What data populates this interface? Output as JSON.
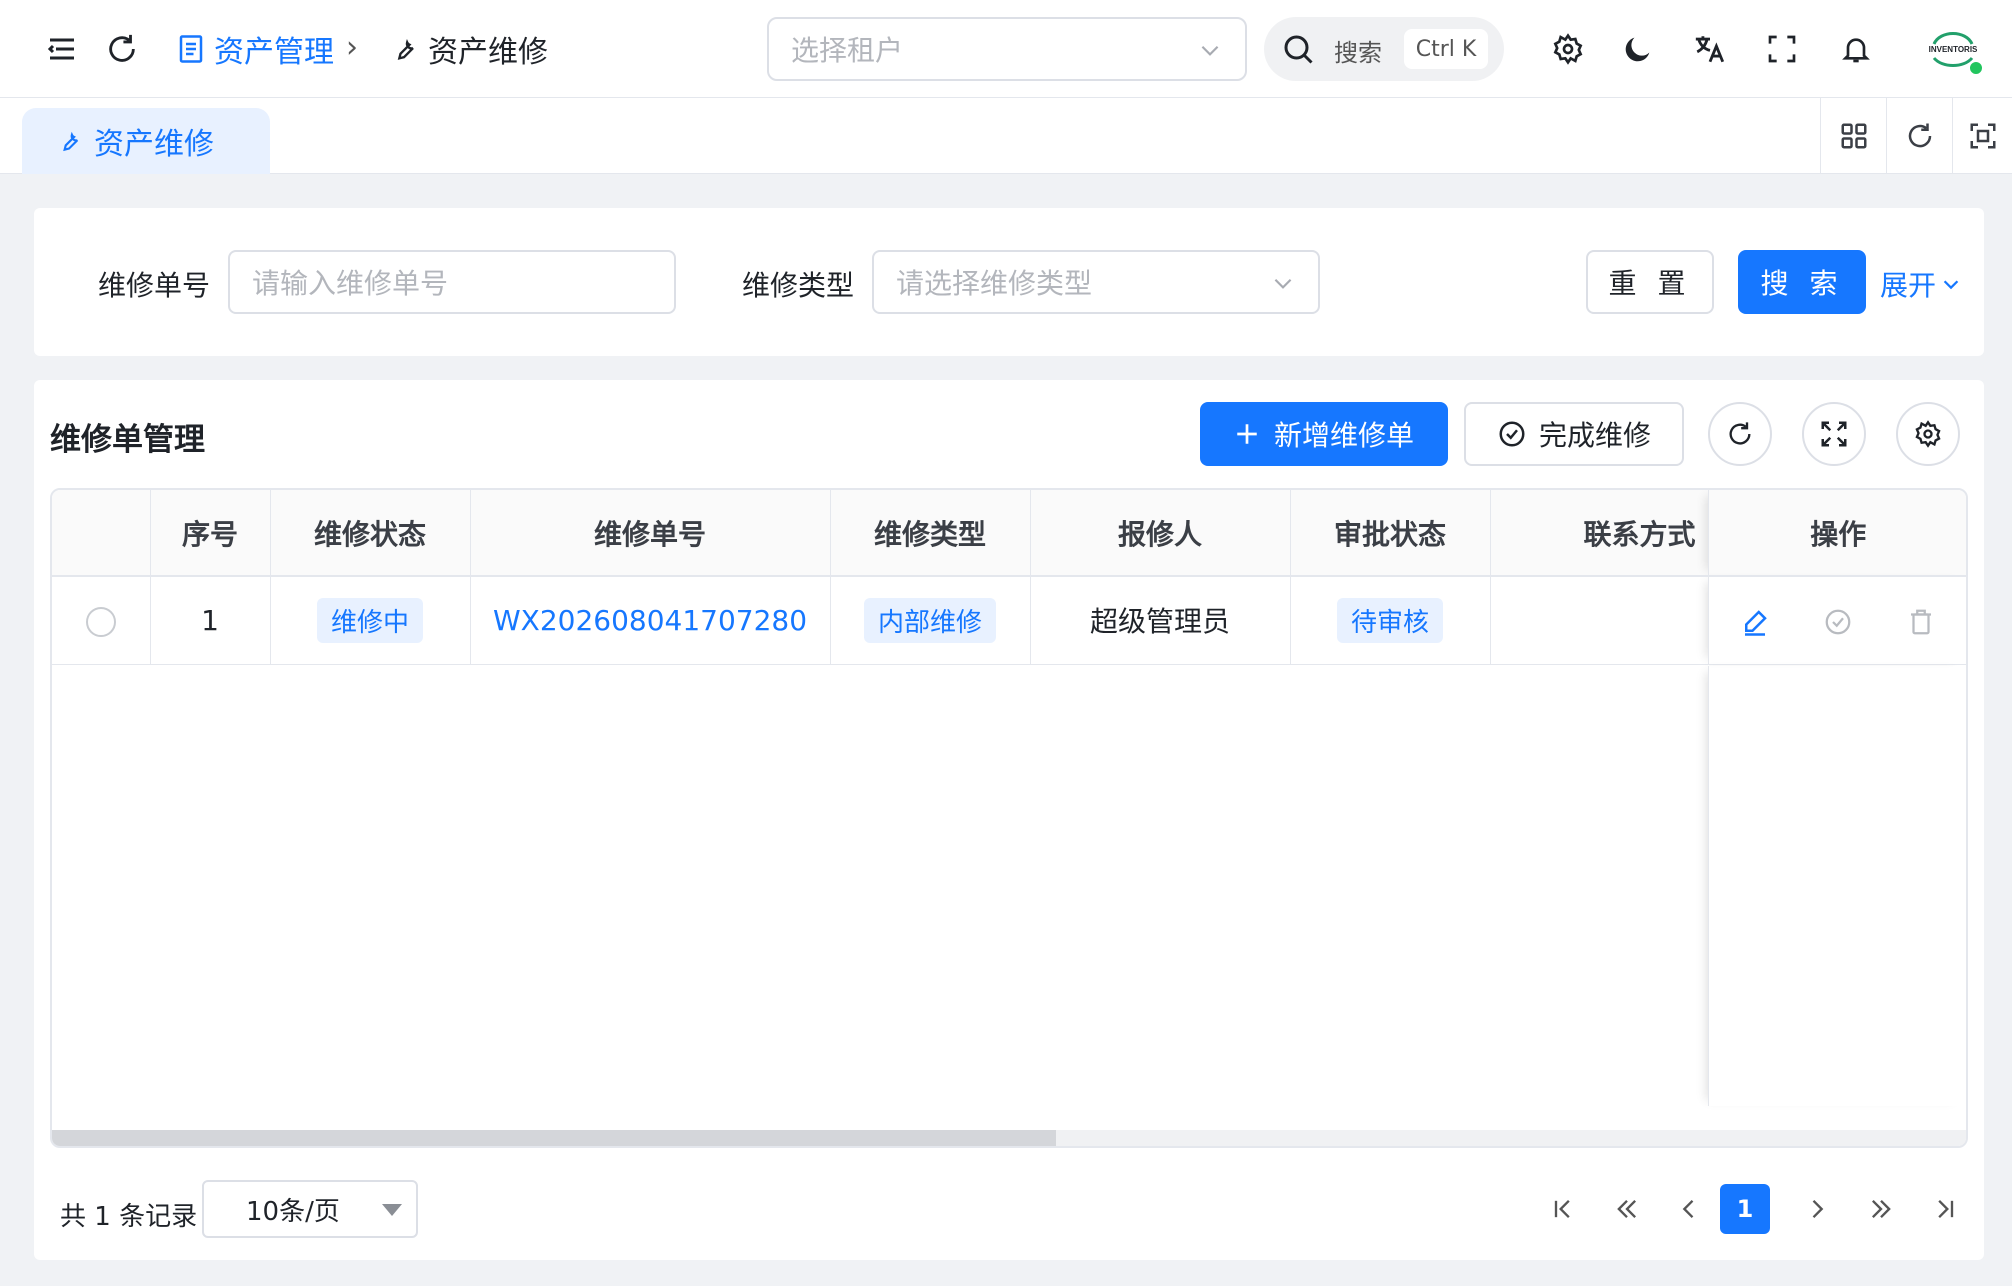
{
  "header": {
    "breadcrumb": [
      "资产管理",
      "资产维修"
    ],
    "tenant_placeholder": "选择租户",
    "search_label": "搜索",
    "search_shortcut": "Ctrl K",
    "avatar_text": "INVENTORIS"
  },
  "tabs": [
    {
      "label": "资产维修",
      "active": true
    }
  ],
  "filters": {
    "fields": [
      {
        "label": "维修单号",
        "placeholder": "请输入维修单号"
      },
      {
        "label": "维修类型",
        "placeholder": "请选择维修类型"
      }
    ],
    "reset_label": "重 置",
    "search_label": "搜 索",
    "expand_label": "展开"
  },
  "table": {
    "title": "维修单管理",
    "add_label": "新增维修单",
    "complete_label": "完成维修",
    "columns": [
      "",
      "序号",
      "维修状态",
      "维修单号",
      "维修类型",
      "报修人",
      "审批状态",
      "联系方式",
      "操作"
    ],
    "rows": [
      {
        "index": "1",
        "repair_status": "维修中",
        "order_no": "WX202608041707280",
        "repair_type": "内部维修",
        "reporter": "超级管理员",
        "approval_status": "待审核",
        "contact": ""
      }
    ]
  },
  "pagination": {
    "total_text": "共 1 条记录",
    "page_size": "10条/页",
    "current_page": "1"
  },
  "colors": {
    "primary": "#1677ff",
    "tag_bg": "#e8f1ff",
    "online": "#22c55e"
  }
}
